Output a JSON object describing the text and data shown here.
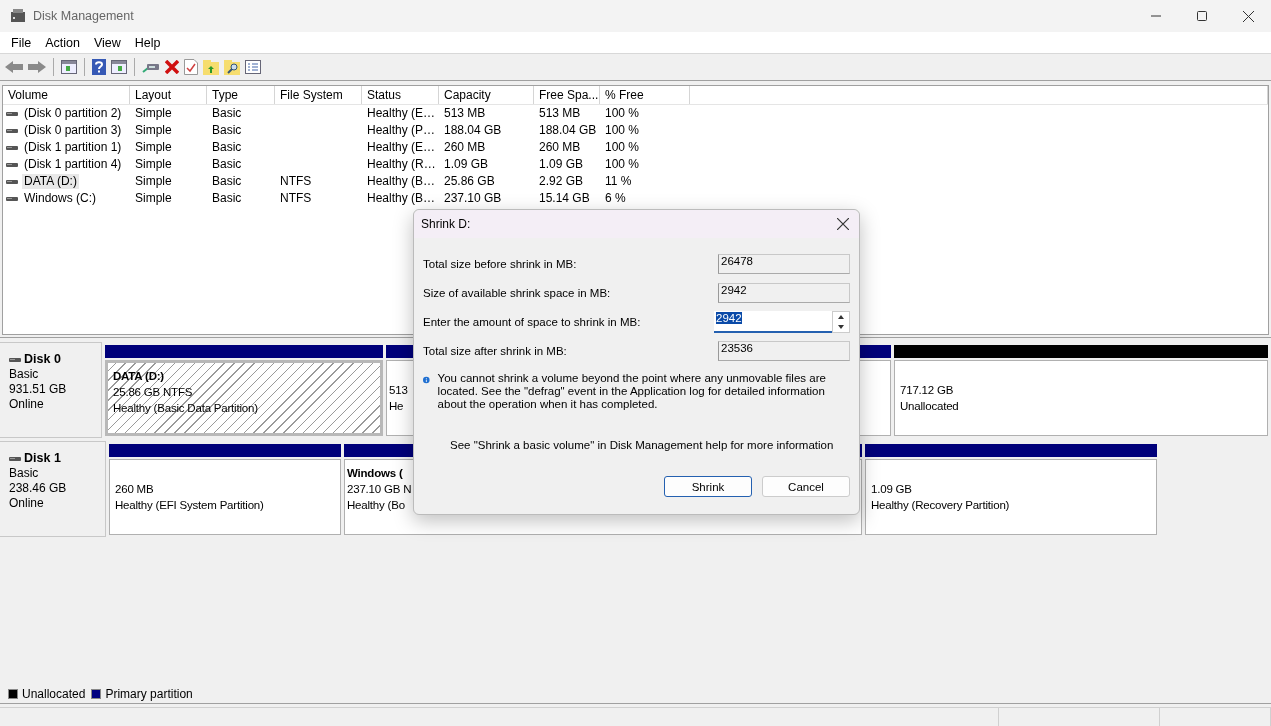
{
  "window": {
    "title": "Disk Management"
  },
  "menu": [
    "File",
    "Action",
    "View",
    "Help"
  ],
  "table": {
    "columns": [
      "Volume",
      "Layout",
      "Type",
      "File System",
      "Status",
      "Capacity",
      "Free Spa...",
      "% Free"
    ],
    "rows": [
      {
        "selected": false,
        "cells": [
          "(Disk 0 partition 2)",
          "Simple",
          "Basic",
          "",
          "Healthy (E…",
          "513 MB",
          "513 MB",
          "100 %"
        ]
      },
      {
        "selected": false,
        "cells": [
          "(Disk 0 partition 3)",
          "Simple",
          "Basic",
          "",
          "Healthy (P…",
          "188.04 GB",
          "188.04 GB",
          "100 %"
        ]
      },
      {
        "selected": false,
        "cells": [
          "(Disk 1 partition 1)",
          "Simple",
          "Basic",
          "",
          "Healthy (E…",
          "260 MB",
          "260 MB",
          "100 %"
        ]
      },
      {
        "selected": false,
        "cells": [
          "(Disk 1 partition 4)",
          "Simple",
          "Basic",
          "",
          "Healthy (R…",
          "1.09 GB",
          "1.09 GB",
          "100 %"
        ]
      },
      {
        "selected": true,
        "cells": [
          "DATA (D:)",
          "Simple",
          "Basic",
          "NTFS",
          "Healthy (B…",
          "25.86 GB",
          "2.92 GB",
          "11 %"
        ]
      },
      {
        "selected": false,
        "cells": [
          "Windows (C:)",
          "Simple",
          "Basic",
          "NTFS",
          "Healthy (B…",
          "237.10 GB",
          "15.14 GB",
          "6 %"
        ]
      }
    ]
  },
  "disks": [
    {
      "name": "Disk 0",
      "type": "Basic",
      "size": "931.51 GB",
      "status": "Online",
      "partitions": [
        {
          "kind": "primary",
          "selected": true,
          "name": "DATA  (D:)",
          "lines": [
            "25.86 GB NTFS",
            "Healthy (Basic Data Partition)"
          ]
        },
        {
          "kind": "primary",
          "selected": false,
          "lines": [
            "513",
            "He"
          ]
        },
        {
          "kind": "primary",
          "selected": false
        },
        {
          "kind": "unallocated",
          "selected": false,
          "lines": [
            "717.12 GB",
            "Unallocated"
          ]
        }
      ]
    },
    {
      "name": "Disk 1",
      "type": "Basic",
      "size": "238.46 GB",
      "status": "Online",
      "partitions": [
        {
          "kind": "primary",
          "selected": false,
          "lines": [
            "260 MB",
            "Healthy (EFI System Partition)"
          ]
        },
        {
          "kind": "primary",
          "selected": false,
          "name": "Windows  (",
          "lines": [
            "237.10 GB N",
            "Healthy (Bo"
          ]
        },
        {
          "kind": "primary",
          "selected": false,
          "lines": [
            "1.09 GB",
            "Healthy (Recovery Partition)"
          ]
        }
      ]
    }
  ],
  "legend": [
    {
      "label": "Unallocated",
      "color": "#000000"
    },
    {
      "label": "Primary partition",
      "color": "#000080"
    }
  ],
  "dialog": {
    "title": "Shrink D:",
    "fields": [
      {
        "kind": "readonly",
        "label": "Total size before shrink in MB:",
        "value": "26478"
      },
      {
        "kind": "readonly",
        "label": "Size of available shrink space in MB:",
        "value": "2942"
      },
      {
        "kind": "spin",
        "label": "Enter the amount of space to shrink in MB:",
        "value": "2942",
        "focused": true
      },
      {
        "kind": "readonly",
        "label": "Total size after shrink in MB:",
        "value": "23536"
      }
    ],
    "info": "You cannot shrink a volume beyond the point where any unmovable files are located. See the \"defrag\" event in the Application log for detailed information about the operation when it has completed.",
    "help": "See \"Shrink a basic volume\" in Disk Management help for more information",
    "buttons": [
      {
        "label": "Shrink",
        "default": true
      },
      {
        "label": "Cancel",
        "default": false
      }
    ]
  }
}
